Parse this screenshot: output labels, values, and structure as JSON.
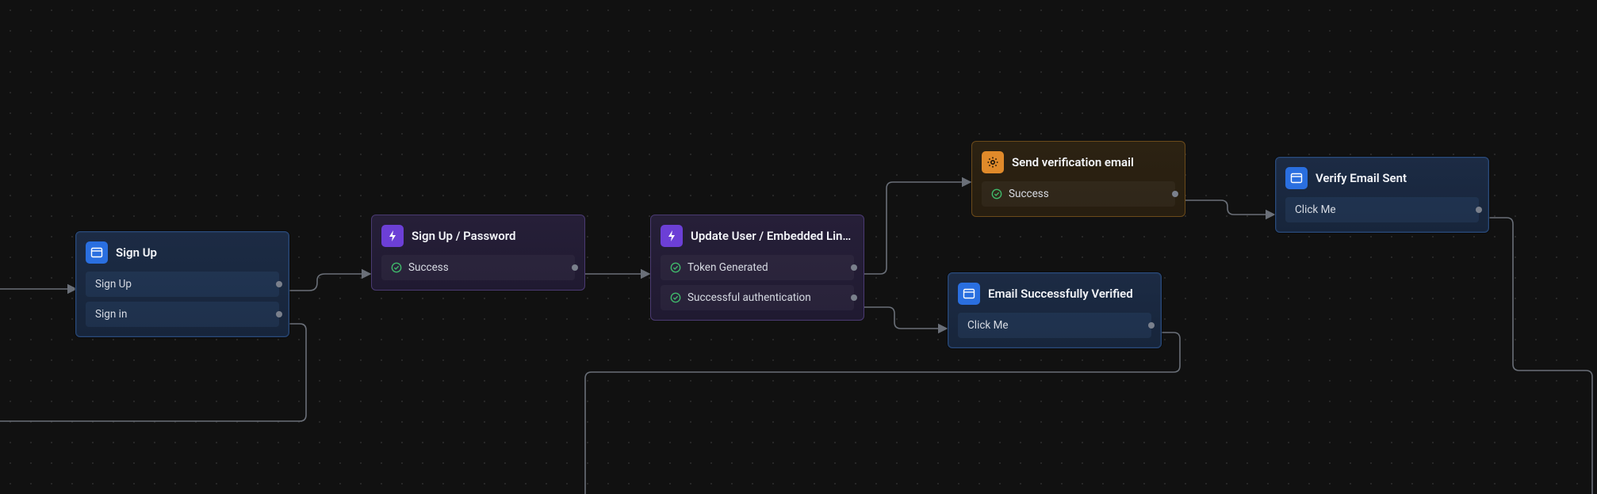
{
  "nodes": [
    {
      "id": "n0",
      "type": "screen",
      "title": "Sign Up",
      "rows": [
        {
          "status": null,
          "label": "Sign Up"
        },
        {
          "status": null,
          "label": "Sign in"
        }
      ]
    },
    {
      "id": "n1",
      "type": "action",
      "title": "Sign Up / Password",
      "rows": [
        {
          "status": "success",
          "label": "Success"
        }
      ]
    },
    {
      "id": "n2",
      "type": "action",
      "title": "Update User / Embedded Link /…",
      "rows": [
        {
          "status": "success",
          "label": "Token Generated"
        },
        {
          "status": "success",
          "label": "Successful authentication"
        }
      ]
    },
    {
      "id": "n3",
      "type": "system",
      "title": "Send verification email",
      "rows": [
        {
          "status": "success",
          "label": "Success"
        }
      ]
    },
    {
      "id": "n4",
      "type": "screen",
      "title": "Email Successfully Verified",
      "rows": [
        {
          "status": null,
          "label": "Click Me"
        }
      ]
    },
    {
      "id": "n5",
      "type": "screen",
      "title": "Verify Email Sent",
      "rows": [
        {
          "status": null,
          "label": "Click Me"
        }
      ]
    }
  ],
  "colors": {
    "screen": "#2a6fe0",
    "action": "#6c3fd6",
    "system": "#e08a2a",
    "edge": "#6a6f78",
    "success": "#3fb86a"
  }
}
